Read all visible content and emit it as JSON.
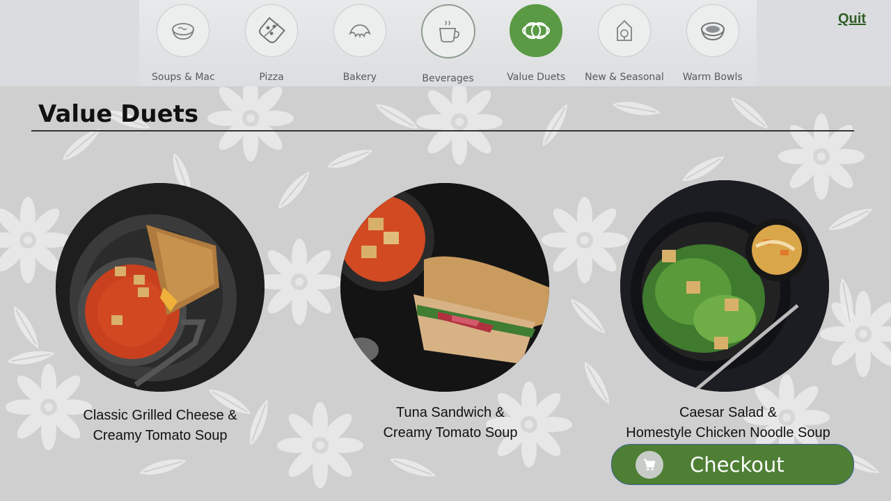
{
  "app": {
    "quit_label": "Quit"
  },
  "nav": {
    "items": [
      {
        "label": "Soups & Mac",
        "icon": "soup-bowl-icon"
      },
      {
        "label": "Pizza",
        "icon": "pizza-icon"
      },
      {
        "label": "Bakery",
        "icon": "croissant-icon"
      },
      {
        "label": "Beverages",
        "icon": "coffee-cup-icon"
      },
      {
        "label": "Value Duets",
        "icon": "value-duets-icon",
        "selected": true
      },
      {
        "label": "New & Seasonal",
        "icon": "seasonal-icon"
      },
      {
        "label": "Warm Bowls",
        "icon": "warm-bowl-icon"
      }
    ]
  },
  "page": {
    "title": "Value Duets"
  },
  "products": [
    {
      "line1": "Classic Grilled Cheese &",
      "line2": "Creamy Tomato Soup"
    },
    {
      "line1": "Tuna Sandwich &",
      "line2": "Creamy Tomato Soup"
    },
    {
      "line1": "Caesar Salad &",
      "line2": "Homestyle Chicken Noodle Soup"
    }
  ],
  "checkout": {
    "label": "Checkout",
    "icon": "cart-icon"
  },
  "colors": {
    "accent_green": "#5a9a45",
    "checkout_green": "#4e7f35",
    "quit_green": "#2f5e26",
    "background": "#cfcfcf"
  }
}
